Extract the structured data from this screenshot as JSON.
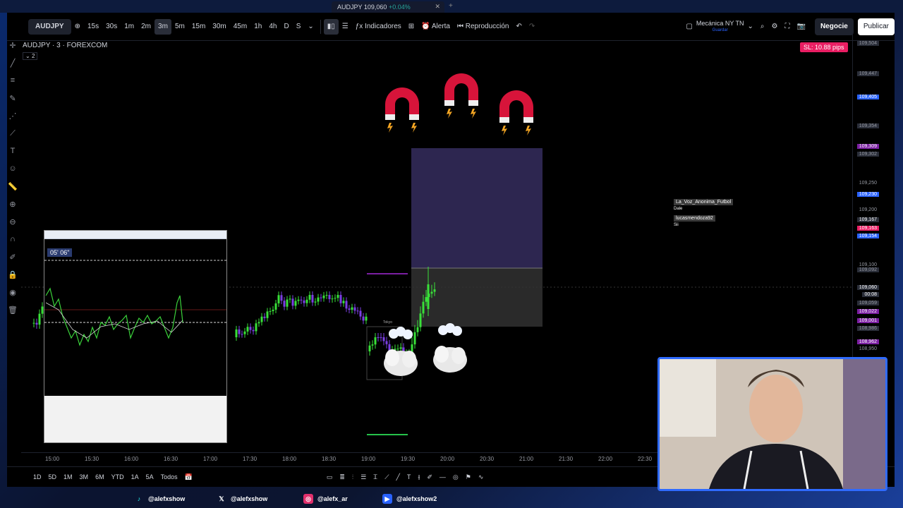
{
  "browser": {
    "tab_title": "AUDJPY",
    "tab_price": "109,060",
    "tab_change": "+0.04%"
  },
  "toolbar": {
    "symbol": "AUDJPY",
    "intervals": [
      "15s",
      "30s",
      "1m",
      "2m",
      "3m",
      "5m",
      "15m",
      "30m",
      "45m",
      "1h",
      "4h",
      "D",
      "S"
    ],
    "active_interval": "3m",
    "indicators_label": "Indicadores",
    "alert_label": "Alerta",
    "replay_label": "Reproducción",
    "layout_name": "Mecánica NY TN",
    "layout_sub": "Guardar",
    "trade_label": "Negocie",
    "publish_label": "Publicar"
  },
  "chart": {
    "legend": "AUDJPY · 3 · FOREXCOM",
    "legend_sub": "2",
    "sl_badge": "SL: 10.88 pips",
    "price_labels": [
      {
        "v": "109,504",
        "hl": false,
        "color": "#2a2e39"
      },
      {
        "v": "109,447",
        "hl": false,
        "color": "#2a2e39"
      },
      {
        "v": "109,405",
        "hl": true,
        "color": "#2962ff"
      },
      {
        "v": "109,354",
        "hl": false,
        "color": "#2a2e39"
      },
      {
        "v": "109,309",
        "hl": true,
        "color": "#7b1fa2"
      },
      {
        "v": "109,302",
        "hl": false,
        "color": "#2a2e39"
      },
      {
        "v": "109,250",
        "hl": false,
        "color": ""
      },
      {
        "v": "109,230",
        "hl": true,
        "color": "#2962ff"
      },
      {
        "v": "109,200",
        "hl": false,
        "color": ""
      },
      {
        "v": "109,167",
        "hl": true,
        "color": "#2a2e39"
      },
      {
        "v": "109,163",
        "hl": true,
        "color": "#e91e63"
      },
      {
        "v": "109,154",
        "hl": true,
        "color": "#2962ff"
      },
      {
        "v": "109,100",
        "hl": false,
        "color": ""
      },
      {
        "v": "109,092",
        "hl": false,
        "color": "#2a2e39"
      },
      {
        "v": "109,060",
        "hl": true,
        "color": "#2a2e39"
      },
      {
        "v": "00:08",
        "hl": true,
        "color": "#2a2e39"
      },
      {
        "v": "109,059",
        "hl": false,
        "color": "#2a2e39"
      },
      {
        "v": "109,022",
        "hl": true,
        "color": "#7b1fa2"
      },
      {
        "v": "109,001",
        "hl": true,
        "color": "#7b1fa2"
      },
      {
        "v": "108,986",
        "hl": false,
        "color": "#2a2e39"
      },
      {
        "v": "108,962",
        "hl": true,
        "color": "#7b1fa2"
      },
      {
        "v": "108,950",
        "hl": false,
        "color": ""
      }
    ],
    "time_labels": [
      "15:00",
      "15:30",
      "16:00",
      "16:30",
      "17:00",
      "17:30",
      "18:00",
      "18:30",
      "19:00",
      "19:30",
      "20:00",
      "20:30",
      "21:00",
      "21:30",
      "22:00",
      "22:30"
    ],
    "session_label": "Tokyo"
  },
  "bottombar": {
    "ranges": [
      "1D",
      "5D",
      "1M",
      "3M",
      "6M",
      "YTD",
      "1A",
      "5A",
      "Todos"
    ]
  },
  "mt4": {
    "timer": "05' 06\""
  },
  "chat": [
    {
      "name": "La_Voz_Anonima_Futbol",
      "msg": "Dale"
    },
    {
      "name": "lucasmendoza92",
      "msg": "Sii"
    }
  ],
  "social": [
    {
      "icon": "tiktok-icon",
      "handle": "@alefxshow",
      "color": "#25f4ee"
    },
    {
      "icon": "x-icon",
      "handle": "@alefxshow",
      "color": "#ffffff"
    },
    {
      "icon": "instagram-icon",
      "handle": "@alefx_ar",
      "color": "#e1306c"
    },
    {
      "icon": "youtube-icon",
      "handle": "@alefxshow2",
      "color": "#ff0000"
    }
  ]
}
